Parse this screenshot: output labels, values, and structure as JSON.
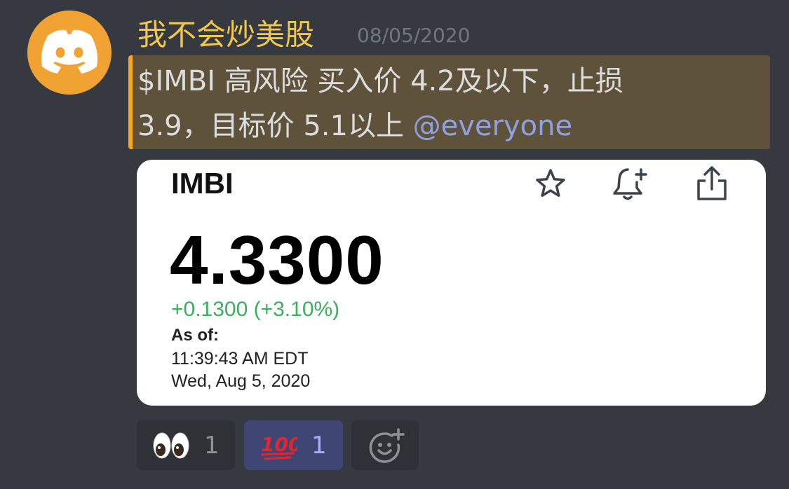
{
  "message": {
    "author": "我不会炒美股",
    "timestamp": "08/05/2020",
    "text_line1": "$IMBI 高风险 买入价 4.2及以下，止损",
    "text_line2": "3.9，目标价 5.1以上 ",
    "mention": "@everyone",
    "avatar_icon": "discord-logo-icon",
    "avatar_color": "#f0a232",
    "author_color": "#f0c84b",
    "highlight_color": "#faa81a"
  },
  "card": {
    "ticker": "IMBI",
    "price": "4.3300",
    "change": "+0.1300 (+3.10%)",
    "change_color": "#3cae5f",
    "as_of_label": "As of:",
    "as_of_time": "11:39:43 AM EDT",
    "as_of_date": "Wed, Aug 5, 2020",
    "icons": [
      "star-icon",
      "bell-plus-icon",
      "share-icon"
    ]
  },
  "reactions": [
    {
      "emoji": "eyes-emoji",
      "count": "1",
      "active": false
    },
    {
      "emoji": "hundred-points-emoji",
      "count": "1",
      "active": true
    },
    {
      "emoji": "add-reaction-icon",
      "count": "",
      "active": false
    }
  ]
}
